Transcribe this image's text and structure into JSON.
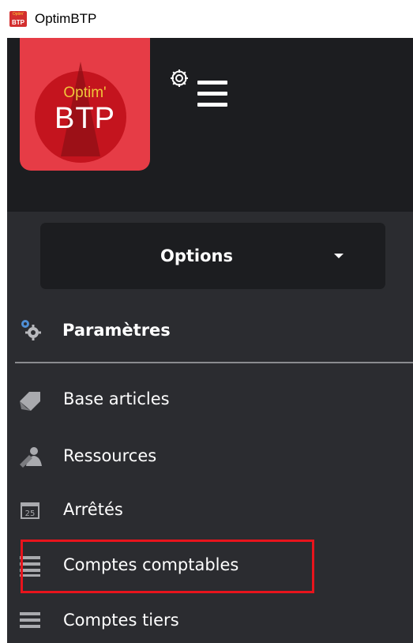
{
  "window": {
    "title": "OptimBTP",
    "icon": "optimbtp-app-icon"
  },
  "logo": {
    "top_text": "Optim'",
    "main_text": "BTP"
  },
  "toolbar": {
    "settings_icon": "gear-icon",
    "menu_icon": "hamburger-menu-icon"
  },
  "options_dropdown": {
    "label": "Options",
    "icon": "caret-down-icon"
  },
  "section": {
    "label": "Paramètres",
    "icon": "gears-icon"
  },
  "nav": {
    "items": [
      {
        "label": "Base articles",
        "icon": "tag-icon"
      },
      {
        "label": "Ressources",
        "icon": "ressources-icon"
      },
      {
        "label": "Arrêtés",
        "icon": "calendar-icon",
        "icon_text": "25"
      },
      {
        "label": "Comptes comptables",
        "icon": "list-icon",
        "highlighted": true
      },
      {
        "label": "Comptes tiers",
        "icon": "list-icon"
      }
    ]
  },
  "colors": {
    "sidebar_bg": "#2b2c30",
    "header_bg": "#1c1d20",
    "logo_bg": "#e63c46",
    "highlight_border": "#e8141c",
    "text": "#ffffff",
    "icon_gray": "#9a9b9f"
  }
}
